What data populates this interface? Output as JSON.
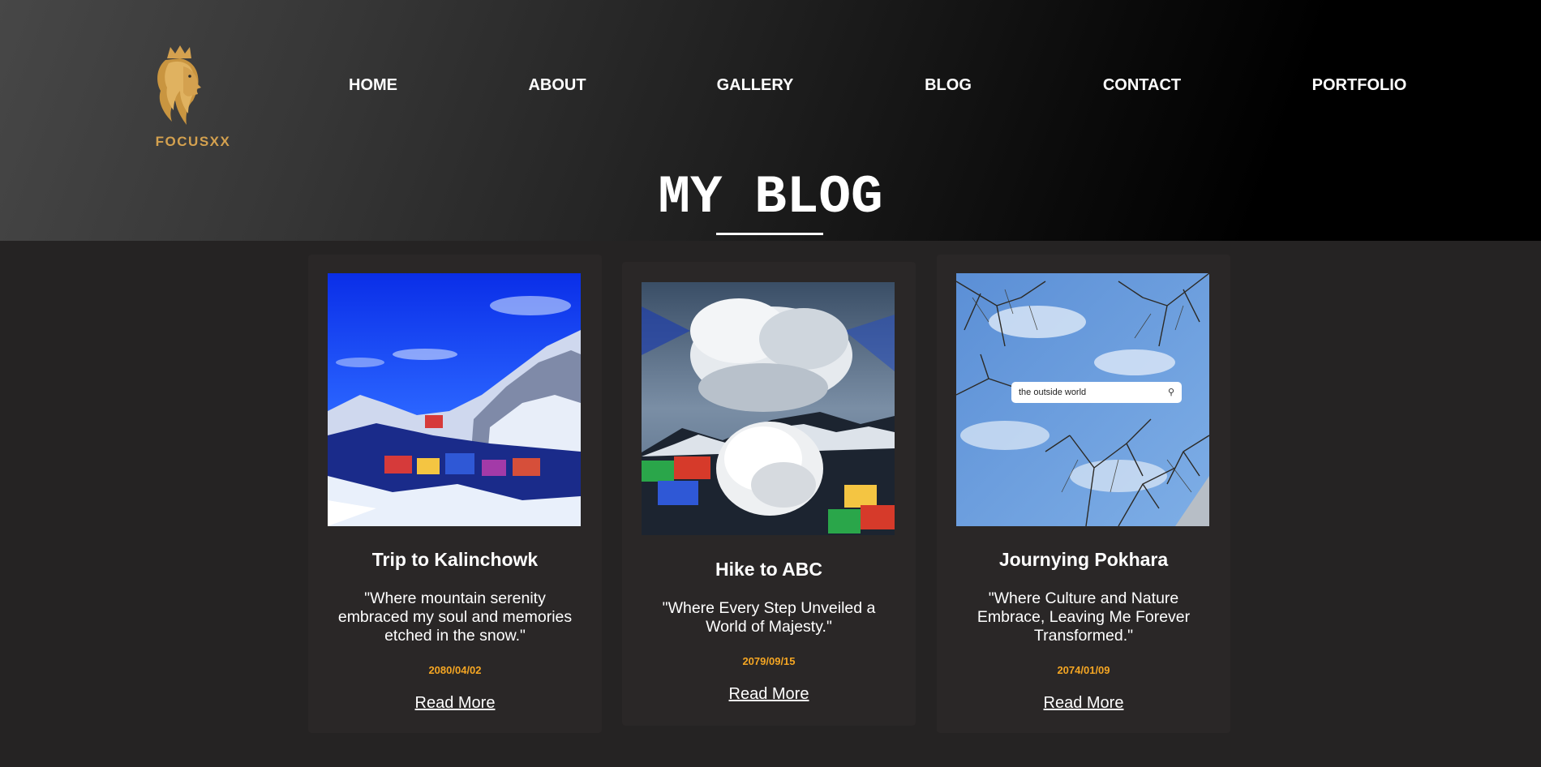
{
  "brand": {
    "name": "FOCUSXX",
    "accent_color": "#d4a14f"
  },
  "nav": {
    "items": [
      "HOME",
      "ABOUT",
      "GALLERY",
      "BLOG",
      "CONTACT",
      "PORTFOLIO"
    ]
  },
  "page": {
    "title": "MY BLOG"
  },
  "posts": [
    {
      "title": "Trip to Kalinchowk",
      "quote": "\"Where mountain serenity embraced my soul and memories etched in the snow.\"",
      "date": "2080/04/02",
      "link": "Read More"
    },
    {
      "title": "Hike to ABC",
      "quote": "\"Where Every Step Unveiled a World of Majesty.\"",
      "date": "2079/09/15",
      "link": "Read More"
    },
    {
      "title": "Journying Pokhara",
      "quote": "\"Where Culture and Nature Embrace, Leaving Me Forever Transformed.\"",
      "date": "2074/01/09",
      "link": "Read More",
      "image_overlay_search": "the outside world"
    }
  ],
  "colors": {
    "date": "#f5a623",
    "card_bg": "#2a2727",
    "page_bg": "#252323"
  }
}
